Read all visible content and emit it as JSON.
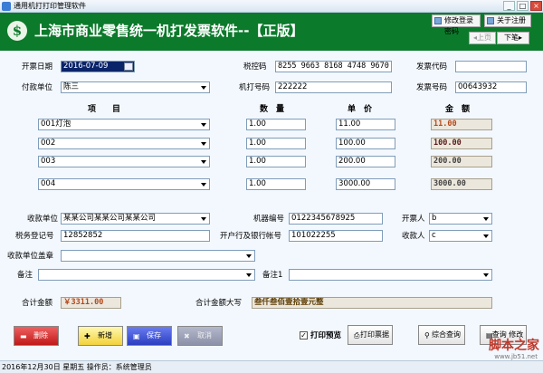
{
  "window": {
    "title": "通用机打打印管理软件"
  },
  "banner": {
    "title": "上海市商业零售统一机打发票软件--【正版】",
    "modify_password": "修改登录密码",
    "about_register": "关于注册",
    "prev": "上页",
    "next": "下笔"
  },
  "header": {
    "issue_date_label": "开票日期",
    "issue_date": "2016-07-09",
    "tax_code_label": "税控码",
    "tax_code": "8255 9663 8168 4748 9670",
    "invoice_code_label": "发票代码",
    "invoice_code": "",
    "payer_label": "付款单位",
    "payer": "陈三",
    "machine_no_label": "机打号码",
    "machine_no": "222222",
    "invoice_no_label": "发票号码",
    "invoice_no": "00643932"
  },
  "items_table": {
    "columns": [
      "项　　目",
      "数　量",
      "单　价",
      "金　额"
    ],
    "rows": [
      {
        "item": "001灯泡",
        "qty": "1.00",
        "price": "11.00",
        "amount": "11.00"
      },
      {
        "item": "002",
        "qty": "1.00",
        "price": "100.00",
        "amount": "100.00"
      },
      {
        "item": "003",
        "qty": "1.00",
        "price": "200.00",
        "amount": "200.00"
      },
      {
        "item": "004",
        "qty": "1.00",
        "price": "3000.00",
        "amount": "3000.00"
      }
    ]
  },
  "footer_fields": {
    "payee_label": "收款单位",
    "payee": "某某公司某某公司某某公司",
    "machine_id_label": "机器编号",
    "machine_id": "0122345678925",
    "drawer_label": "开票人",
    "drawer": "b",
    "tax_reg_label": "税务登记号",
    "tax_reg": "12852852",
    "bank_label": "开户行及银行帐号",
    "bank": "101022255",
    "receiver_label": "收款人",
    "receiver": "c",
    "seal_label": "收款单位盖章",
    "seal": "",
    "remark_label": "备注",
    "remark": "",
    "remark1_label": "备注1",
    "remark1": "",
    "total_label": "合计金额",
    "total": "￥3311.00",
    "total_upper_label": "合计金额大写",
    "total_upper": "叁仟叁佰壹拾壹元整"
  },
  "actions": {
    "delete": "删除",
    "add": "新增",
    "save": "保存",
    "cancel": "取消",
    "print_preview": "打印预览",
    "print_invoice": "打印票据",
    "general_query": "综合查询",
    "query_modify": "查询 修改"
  },
  "status_bar": {
    "text": "2016年12月30日  星期五  操作员：系统管理员"
  },
  "watermark": {
    "brand": "脚本之家",
    "url": "www.jb51.net"
  },
  "colors": {
    "banner": "#0c7a2b",
    "form_bg": "#f3f8fe",
    "selected": "#0a246a"
  }
}
